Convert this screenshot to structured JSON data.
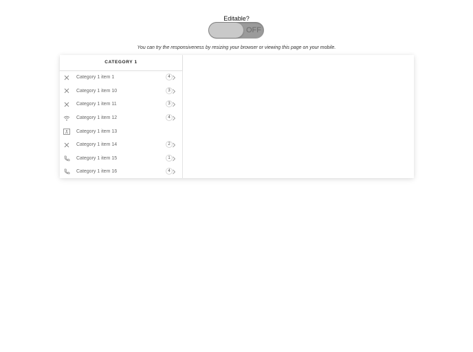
{
  "editable": {
    "label": "Editable?",
    "toggle_state": "OFF"
  },
  "hint": "You can try the responsiveness by resizing your browser or viewing this page on your mobile.",
  "category": {
    "title": "CATEGORY 1",
    "items": [
      {
        "label": "Category 1 item 1",
        "icon": "close-icon",
        "count": "4"
      },
      {
        "label": "Category 1 item 10",
        "icon": "close-icon",
        "count": "3"
      },
      {
        "label": "Category 1 item 11",
        "icon": "close-icon",
        "count": "3"
      },
      {
        "label": "Category 1 item 12",
        "icon": "wifi-icon",
        "count": "4"
      },
      {
        "label": "Category 1 item 13",
        "icon": "contact-card-icon",
        "count": ""
      },
      {
        "label": "Category 1 item 14",
        "icon": "close-icon",
        "count": "2"
      },
      {
        "label": "Category 1 item 15",
        "icon": "phone-icon",
        "count": "1"
      },
      {
        "label": "Category 1 item 16",
        "icon": "phone-icon",
        "count": "4"
      }
    ]
  }
}
